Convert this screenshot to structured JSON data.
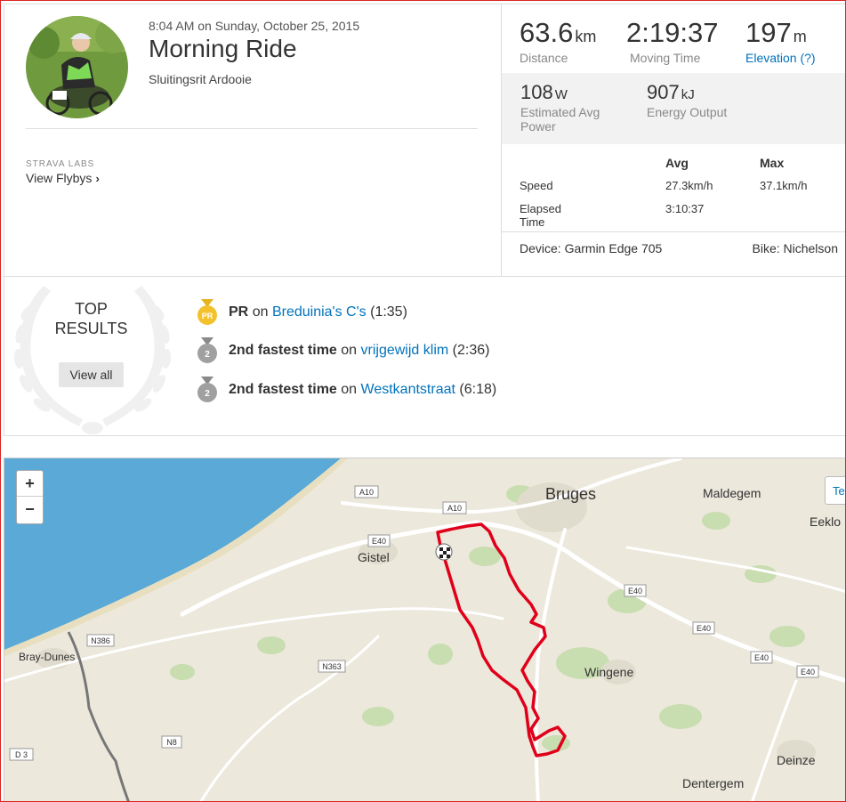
{
  "activity": {
    "date": "8:04 AM on Sunday, October 25, 2015",
    "title": "Morning Ride",
    "description": "Sluitingsrit Ardooie"
  },
  "labs": {
    "label": "STRAVA LABS",
    "flybys": "View Flybys"
  },
  "stats": {
    "distance": {
      "value": "63.6",
      "unit": "km",
      "label": "Distance"
    },
    "moving_time": {
      "value": "2:19:37",
      "label": "Moving Time"
    },
    "elevation": {
      "value": "197",
      "unit": "m",
      "label": "Elevation (?)"
    },
    "power": {
      "value": "108",
      "unit": "W",
      "label_line1": "Estimated Avg",
      "label_line2": "Power"
    },
    "energy": {
      "value": "907",
      "unit": "kJ",
      "label": "Energy Output"
    }
  },
  "more_stats": {
    "col_avg": "Avg",
    "col_max": "Max",
    "speed_label": "Speed",
    "speed_avg": "27.3km/h",
    "speed_max": "37.1km/h",
    "elapsed_label": "Elapsed Time",
    "elapsed_avg": "3:10:37"
  },
  "device": "Device: Garmin Edge 705",
  "bike": "Bike: Nichelson",
  "top_results": {
    "title_line1": "TOP",
    "title_line2": "RESULTS",
    "view_all": "View all",
    "efforts": [
      {
        "badge": "PR",
        "rank": "PR",
        "on": "on",
        "segment": "Breduinia's C's",
        "time": "(1:35)",
        "medal": "gold"
      },
      {
        "badge": "2",
        "rank": "2nd fastest time",
        "on": "on",
        "segment": "vrijgewijd klim",
        "time": "(2:36)",
        "medal": "silver"
      },
      {
        "badge": "2",
        "rank": "2nd fastest time",
        "on": "on",
        "segment": "Westkantstraat",
        "time": "(6:18)",
        "medal": "silver"
      }
    ]
  },
  "map": {
    "zoom_in": "+",
    "zoom_out": "−",
    "side_button": "Te",
    "places": {
      "bruges": "Bruges",
      "maldegem": "Maldegem",
      "eeklo": "Eeklo",
      "gistel": "Gistel",
      "bray_dunes": "Bray-Dunes",
      "wingene": "Wingene",
      "deinze": "Deinze",
      "dentergem": "Dentergem"
    },
    "roads": {
      "a10_1": "A10",
      "a10_2": "A10",
      "e40_1": "E40",
      "e40_2": "E40",
      "e40_3": "E40",
      "e40_4": "E40",
      "e40_5": "E40",
      "n386": "N386",
      "n363": "N363",
      "n8": "N8",
      "d3": "D 3"
    },
    "colors": {
      "sea": "#5aa9d6",
      "land": "#ece8dc",
      "route": "#e0001a",
      "green": "#c8ddb0"
    }
  }
}
